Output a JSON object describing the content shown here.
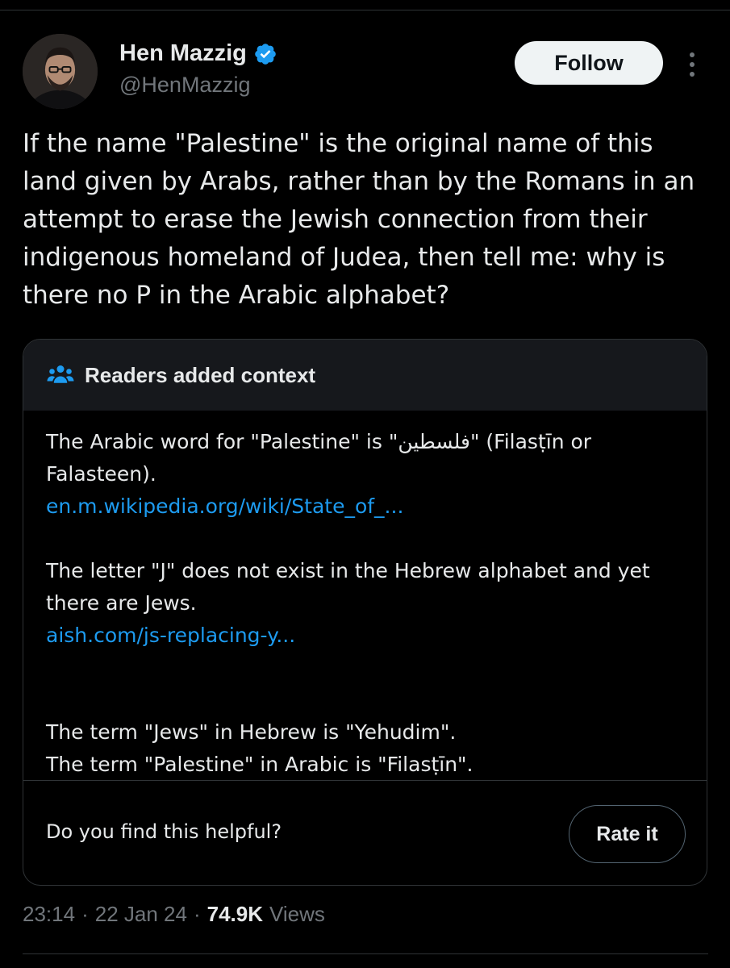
{
  "author": {
    "name": "Hen Mazzig",
    "handle": "@HenMazzig",
    "verified_color": "#1d9bf0"
  },
  "actions": {
    "follow_label": "Follow"
  },
  "tweet": {
    "text": "If the name \"Palestine\" is the original name of this land given by Arabs, rather than by the Romans in an attempt to erase the Jewish connection from their indigenous homeland of Judea, then tell me: why is there no P in the Arabic alphabet?"
  },
  "community_note": {
    "title": "Readers added context",
    "paragraphs": [
      {
        "text": "The Arabic word for \"Palestine\" is \"فلسطين\" (Filasṭīn or Falasteen).",
        "link": "en.m.wikipedia.org/wiki/State_of_..."
      },
      {
        "text": "The letter \"J\" does not exist in the Hebrew alphabet and yet there are Jews.",
        "link": "aish.com/js-replacing-y..."
      },
      {
        "text": "The term \"Jews\" in Hebrew is \"Yehudim\".\nThe term \"Palestine\" in Arabic is \"Filasṭīn\".",
        "link": ""
      }
    ],
    "question": "Do you find this helpful?",
    "rate_label": "Rate it"
  },
  "meta": {
    "time": "23:14",
    "separator": "·",
    "date": "22 Jan 24",
    "views_count": "74.9K",
    "views_label": "Views"
  },
  "colors": {
    "background": "#000000",
    "text": "#e7e9ea",
    "muted": "#71767b",
    "link": "#1d9bf0",
    "note_header_bg": "#16181c"
  }
}
